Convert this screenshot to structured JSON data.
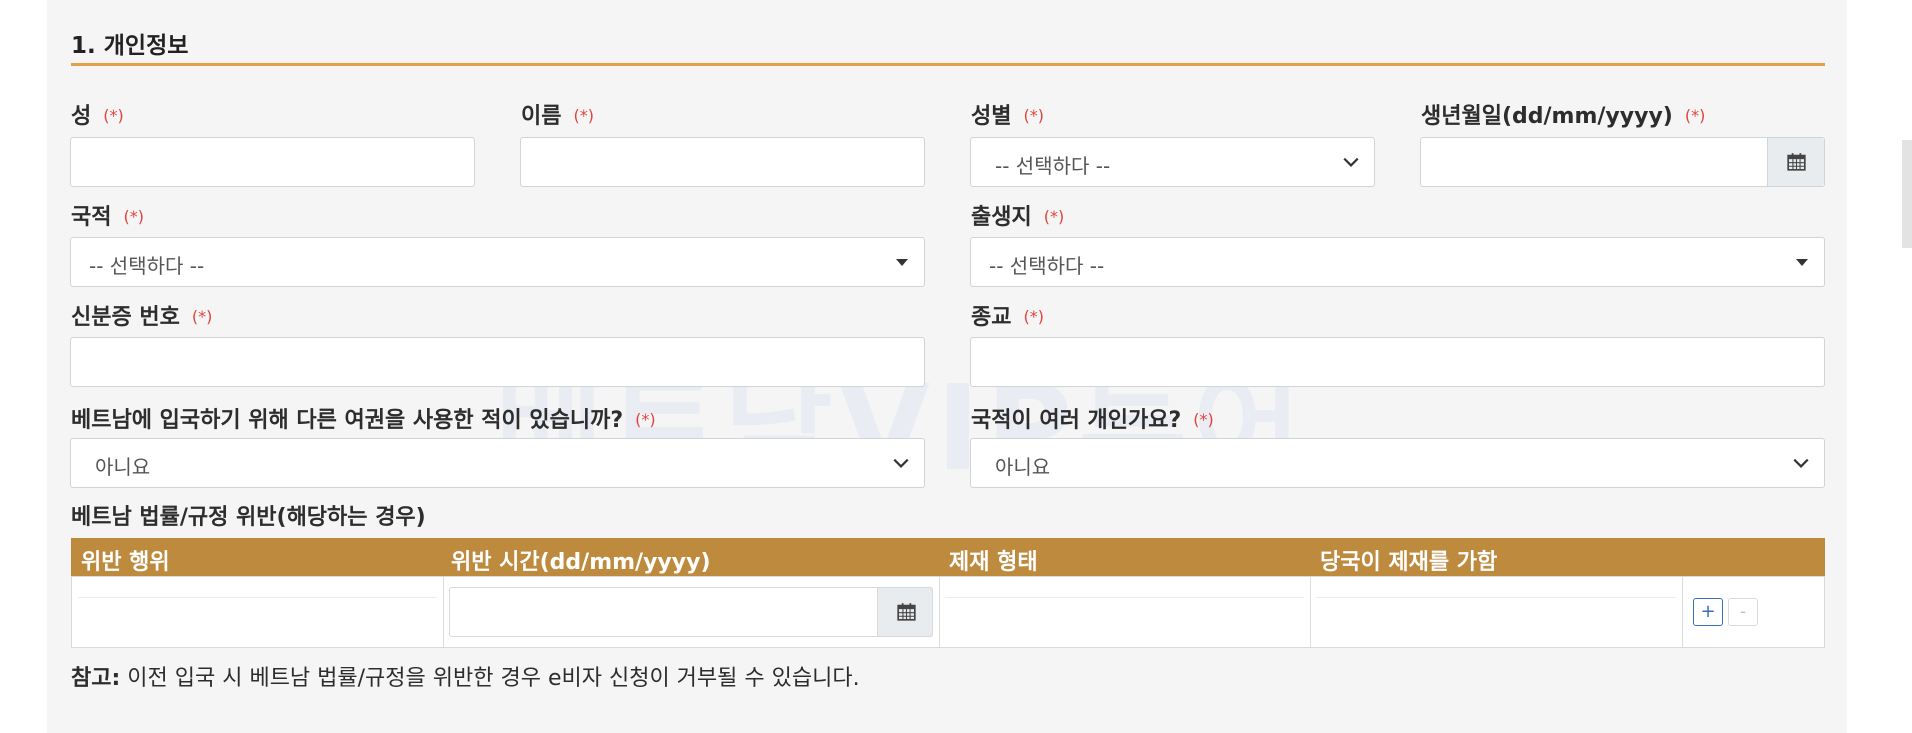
{
  "section": {
    "title": "1. 개인정보"
  },
  "fields": {
    "surname": {
      "label": "성",
      "required": "(*)",
      "value": ""
    },
    "given_name": {
      "label": "이름",
      "required": "(*)",
      "value": ""
    },
    "gender": {
      "label": "성별",
      "required": "(*)",
      "value": "-- 선택하다 --"
    },
    "dob": {
      "label": "생년월일(dd/mm/yyyy)",
      "required": "(*)",
      "value": ""
    },
    "nationality": {
      "label": "국적",
      "required": "(*)",
      "value": "-- 선택하다 --"
    },
    "birthplace": {
      "label": "출생지",
      "required": "(*)",
      "value": "-- 선택하다 --"
    },
    "id_number": {
      "label": "신분증 번호",
      "required": "(*)",
      "value": ""
    },
    "religion": {
      "label": "종교",
      "required": "(*)",
      "value": ""
    },
    "other_passport": {
      "label": "베트남에 입국하기 위해 다른 여권을 사용한 적이 있습니까?",
      "required": "(*)",
      "value": "아니요"
    },
    "multi_nationality": {
      "label": "국적이 여러 개인가요?",
      "required": "(*)",
      "value": "아니요"
    }
  },
  "watermark": "베트남VIP투어",
  "violations": {
    "title": "베트남 법률/규정 위반(해당하는 경우)",
    "columns": [
      "위반 행위",
      "위반 시간(dd/mm/yyyy)",
      "제재 형태",
      "당국이 제재를 가함"
    ],
    "add_label": "+",
    "remove_label": "-"
  },
  "note": {
    "prefix": "참고:",
    "text": " 이전 입국 시 베트남 법률/규정을 위반한 경우 e비자 신청이 거부될 수 있습니다."
  },
  "colors": {
    "accent": "#e2a04a",
    "table_header": "#be8a3e",
    "required": "#e0443e"
  },
  "icons": [
    "calendar-icon",
    "chevron-down-icon",
    "caret-down-icon"
  ]
}
